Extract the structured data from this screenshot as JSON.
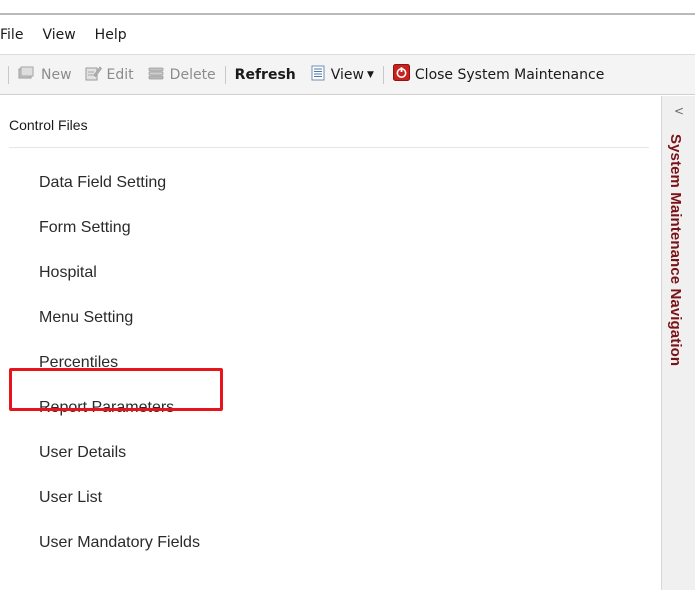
{
  "menubar": {
    "items": [
      {
        "label": "File"
      },
      {
        "label": "View"
      },
      {
        "label": "Help"
      }
    ]
  },
  "toolbar": {
    "new_label": "New",
    "edit_label": "Edit",
    "delete_label": "Delete",
    "refresh_label": "Refresh",
    "view_label": "View",
    "close_label": "Close System Maintenance"
  },
  "nav": {
    "group_label": "Control Files",
    "items": [
      {
        "label": "Data Field Setting"
      },
      {
        "label": "Form Setting"
      },
      {
        "label": "Hospital"
      },
      {
        "label": "Menu Setting"
      },
      {
        "label": "Percentiles"
      },
      {
        "label": "Report Parameters",
        "highlighted": true
      },
      {
        "label": "User Details"
      },
      {
        "label": "User List"
      },
      {
        "label": "User Mandatory Fields"
      }
    ]
  },
  "side_panel": {
    "title": "System Maintenance Navigation",
    "collapse_glyph": "<"
  },
  "colors": {
    "highlight": "#e8141b",
    "side_title": "#7a1216",
    "close_icon": "#c9211e"
  }
}
